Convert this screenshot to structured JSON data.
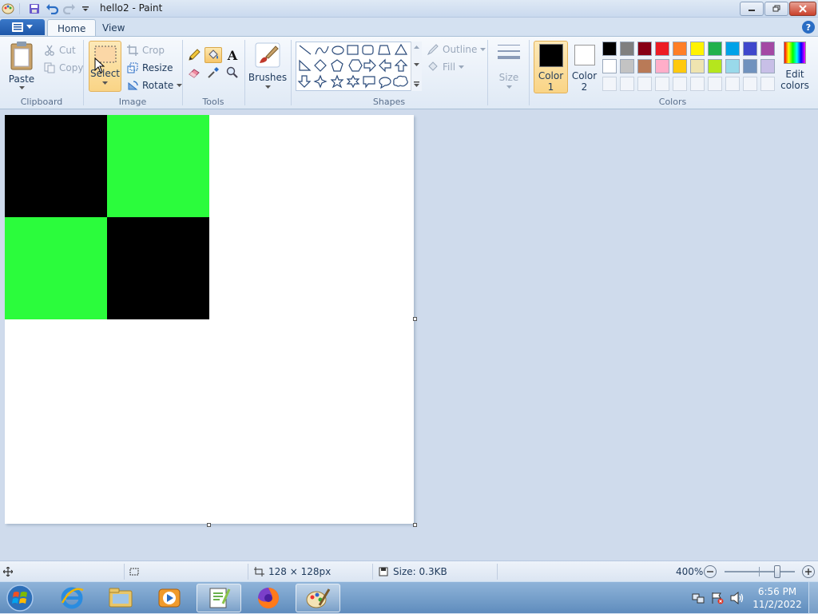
{
  "window": {
    "title": "hello2 - Paint",
    "controls": [
      "minimize",
      "restore",
      "close"
    ]
  },
  "tabs": [
    {
      "label": "Home",
      "active": true
    },
    {
      "label": "View",
      "active": false
    }
  ],
  "clipboard": {
    "label": "Clipboard",
    "paste": "Paste",
    "cut": "Cut",
    "copy": "Copy"
  },
  "image": {
    "label": "Image",
    "select": "Select",
    "crop": "Crop",
    "resize": "Resize",
    "rotate": "Rotate"
  },
  "tools": {
    "label": "Tools",
    "items": [
      "pencil-icon",
      "fill-icon",
      "text-icon",
      "eraser-icon",
      "color-picker-icon",
      "magnifier-icon"
    ],
    "active": "fill-icon"
  },
  "brushes": {
    "label": "Brushes"
  },
  "shapes": {
    "label": "Shapes",
    "outline": "Outline",
    "fill": "Fill"
  },
  "size": {
    "label": "Size"
  },
  "colors": {
    "label": "Colors",
    "color1_label1": "Color",
    "color1_label2": "1",
    "color2_label1": "Color",
    "color2_label2": "2",
    "color1": "#000000",
    "color2": "#ffffff",
    "edit_label1": "Edit",
    "edit_label2": "colors",
    "palette_row1": [
      "#000000",
      "#7f7f7f",
      "#880015",
      "#ed1c24",
      "#ff7f27",
      "#fff200",
      "#22b14c",
      "#00a2e8",
      "#3f48cc",
      "#a349a4"
    ],
    "palette_row2": [
      "#ffffff",
      "#c3c3c3",
      "#b97a57",
      "#ffaec9",
      "#ffc90e",
      "#efe4b0",
      "#b5e61d",
      "#99d9ea",
      "#7092be",
      "#c8bfe7"
    ]
  },
  "canvas_image": {
    "grid": [
      [
        "#000000",
        "#2bfc3c"
      ],
      [
        "#2bfc3c",
        "#000000"
      ]
    ]
  },
  "status": {
    "dimensions": "128 × 128px",
    "size": "Size: 0.3KB",
    "zoom": "400%",
    "zoom_slider_fraction": 0.75
  },
  "taskbar": {
    "items": [
      "start-button",
      "internet-explorer-icon",
      "file-explorer-icon",
      "media-player-icon",
      "notepad-plus-icon",
      "firefox-icon",
      "paint-icon"
    ],
    "time": "6:56 PM",
    "date": "11/2/2022"
  }
}
